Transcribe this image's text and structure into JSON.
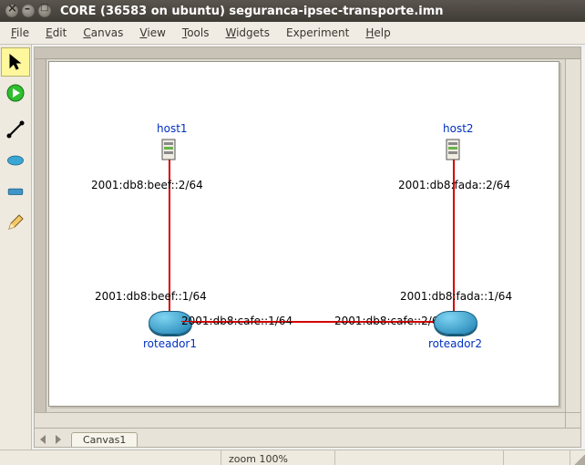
{
  "window": {
    "title": "CORE (36583 on ubuntu) seguranca-ipsec-transporte.imn"
  },
  "menu": {
    "file": "File",
    "edit": "Edit",
    "canvas": "Canvas",
    "view": "View",
    "tools": "Tools",
    "widgets": "Widgets",
    "experiment": "Experiment",
    "help": "Help"
  },
  "toolbar": {
    "select": "select",
    "play": "start",
    "link": "link",
    "router": "router",
    "switch": "switch",
    "pencil": "annotate"
  },
  "canvas_tab": {
    "name": "Canvas1"
  },
  "status": {
    "zoom": "zoom 100%"
  },
  "topology": {
    "host1": {
      "name": "host1",
      "addr": "2001:db8:beef::2/64"
    },
    "host2": {
      "name": "host2",
      "addr": "2001:db8:fada::2/64"
    },
    "r1": {
      "name": "roteador1",
      "eth_up": "2001:db8:beef::1/64",
      "eth_right": "2001:db8:cafe::1/64"
    },
    "r2": {
      "name": "roteador2",
      "eth_up": "2001:db8:fada::1/64",
      "eth_left": "2001:db8:cafe::2/64"
    }
  }
}
